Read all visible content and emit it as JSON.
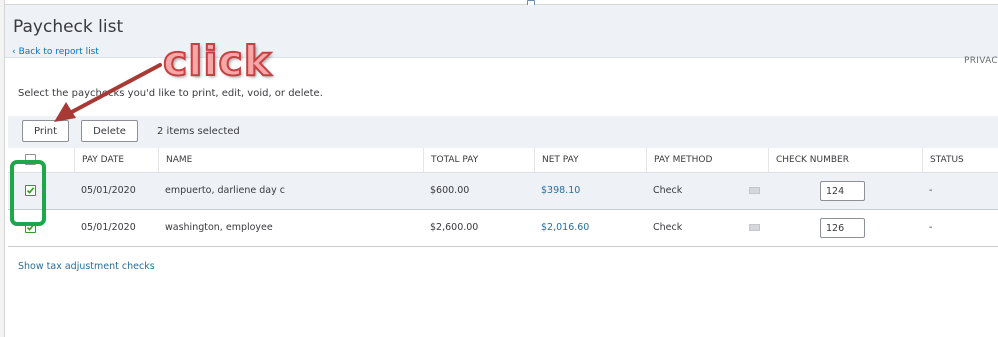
{
  "page": {
    "title": "Paycheck list",
    "back_link": "Back to report list",
    "privacy": "PRIVAC",
    "instructions": "Select the paychecks you'd like to print, edit, void, or delete."
  },
  "toolbar": {
    "print_label": "Print",
    "delete_label": "Delete",
    "selected_count": "2 items selected"
  },
  "table": {
    "headers": {
      "pay_date": "PAY DATE",
      "name": "NAME",
      "total_pay": "TOTAL PAY",
      "net_pay": "NET PAY",
      "pay_method": "PAY METHOD",
      "check_number": "CHECK NUMBER",
      "status": "STATUS"
    },
    "rows": [
      {
        "checked": true,
        "pay_date": "05/01/2020",
        "name": "empuerto, darliene day c",
        "total_pay": "$600.00",
        "net_pay": "$398.10",
        "pay_method": "Check",
        "check_number": "124",
        "status": "-"
      },
      {
        "checked": true,
        "pay_date": "05/01/2020",
        "name": "washington, employee",
        "total_pay": "$2,600.00",
        "net_pay": "$2,016.60",
        "pay_method": "Check",
        "check_number": "126",
        "status": "-"
      }
    ]
  },
  "footer": {
    "tax_link": "Show tax adjustment checks"
  },
  "annotation": {
    "text": "click",
    "arrow_color": "#a83a36",
    "highlight_color": "#1ea64a"
  },
  "icons": {
    "back": "chevron-left-icon",
    "checkbox": "checkbox-icon",
    "memo": "memo-icon"
  }
}
